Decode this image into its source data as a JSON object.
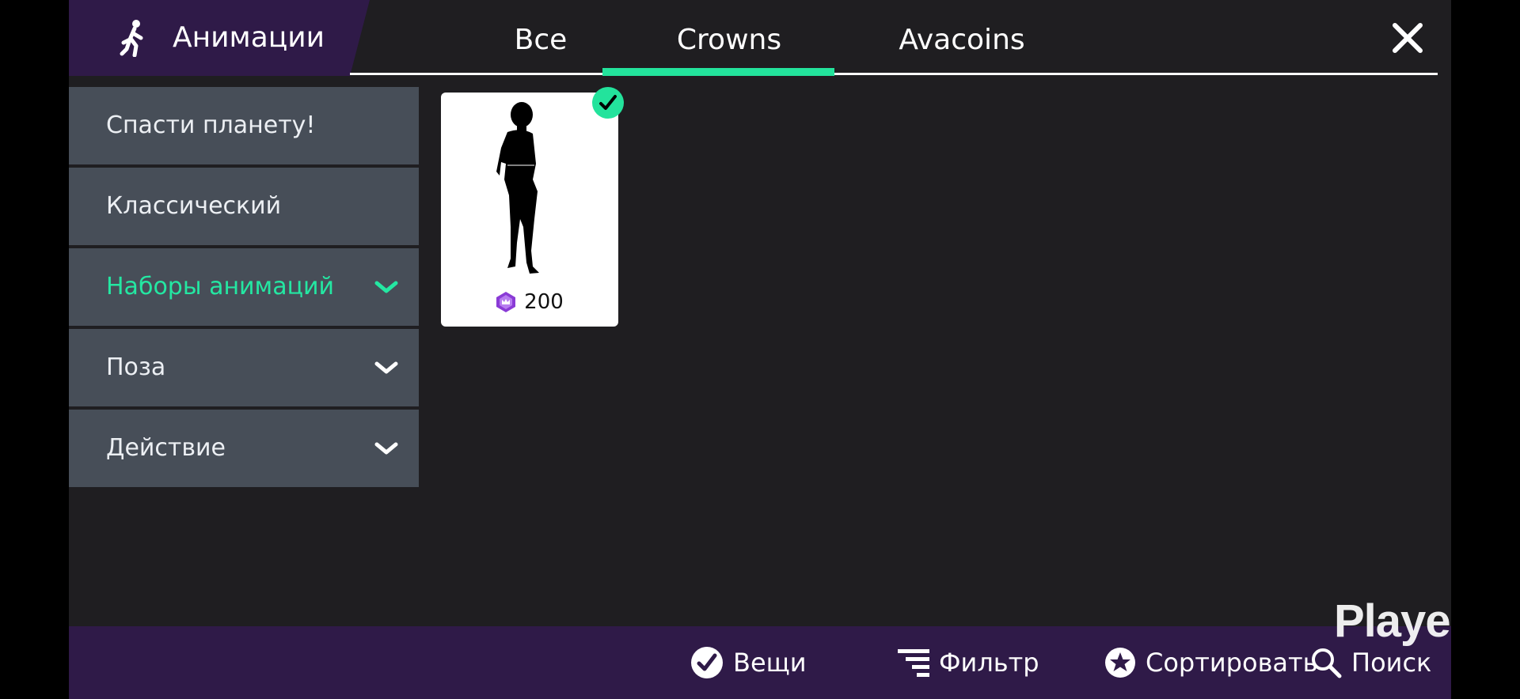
{
  "header": {
    "section_title": "Анимации",
    "section_icon": "walking-person-icon",
    "tabs": [
      {
        "label": "Все",
        "active": false
      },
      {
        "label": "Crowns",
        "active": true
      },
      {
        "label": "Avacoins",
        "active": false
      }
    ],
    "close_icon": "close-icon"
  },
  "sidebar": {
    "items": [
      {
        "label": "Спасти планету!",
        "expandable": false,
        "active": false
      },
      {
        "label": "Классический",
        "expandable": false,
        "active": false
      },
      {
        "label": "Наборы анимаций",
        "expandable": true,
        "active": true
      },
      {
        "label": "Поза",
        "expandable": true,
        "active": false
      },
      {
        "label": "Действие",
        "expandable": true,
        "active": false
      }
    ]
  },
  "items": [
    {
      "price": "200",
      "currency_icon": "crown-icon",
      "selected": true
    }
  ],
  "bottom_bar": {
    "items_label": "Вещи",
    "filter_label": "Фильтр",
    "sort_label": "Сортировать",
    "search_label": "Поиск"
  },
  "watermark": "Playerok",
  "colors": {
    "accent": "#23e39c",
    "header_bg": "#2f1a48",
    "panel_bg": "#1f1e21",
    "sidebar_item_bg": "#474e58",
    "currency": "#8a3bd6"
  }
}
